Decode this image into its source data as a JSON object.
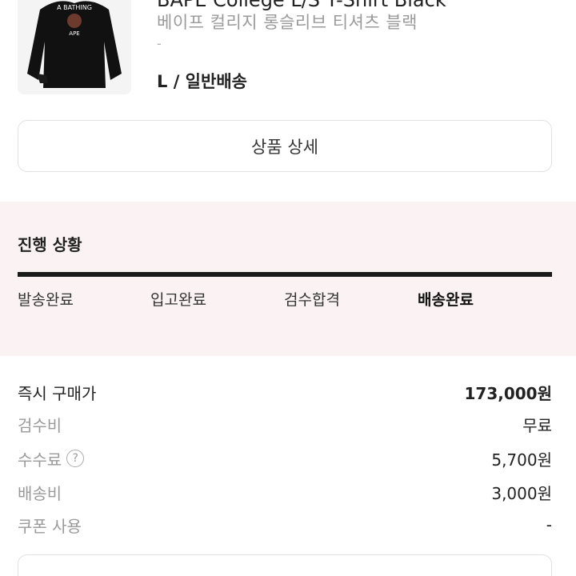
{
  "product": {
    "title": "BAPE College L/S T-Shirt Black",
    "subtitle": "베이프 컬리지 롱슬리브 티셔츠 블랙",
    "dash": "-",
    "option": "L / 일반배송",
    "thumbnail_text_top": "A BATHING",
    "thumbnail_text_bottom": "APE"
  },
  "detail_button": {
    "label": "상품 상세"
  },
  "progress": {
    "title": "진행 상황",
    "fill": 1.0,
    "steps": [
      "발송완료",
      "입고완료",
      "검수합격",
      "배송완료"
    ],
    "active_step": "배송완료"
  },
  "prices": [
    {
      "label": "즉시 구매가",
      "value": "173,000원"
    },
    {
      "label": "검수비",
      "value": "무료"
    },
    {
      "label": "수수료",
      "value": "5,700원"
    },
    {
      "label": "배송비",
      "value": "3,000원"
    },
    {
      "label": "쿠폰 사용",
      "value": "-"
    }
  ],
  "icons": {
    "help": "?"
  },
  "colors": {
    "accent": "#1a1a1a",
    "progress_bg": "#fbf3f3"
  }
}
